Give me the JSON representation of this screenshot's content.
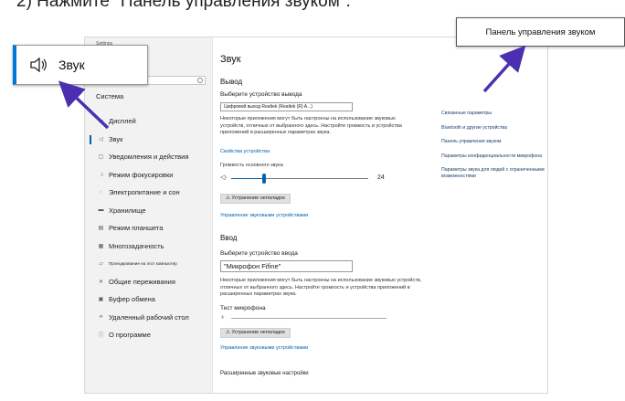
{
  "instruction": "2) Нажмите \"Панель управления звуком\".",
  "window": {
    "title": "Settings",
    "system_label": "Система",
    "nav": [
      {
        "label": "Дисплей",
        "icon": "display-icon",
        "small": false,
        "active": false
      },
      {
        "label": "Звук",
        "icon": "speaker-icon",
        "small": false,
        "active": true
      },
      {
        "label": "Уведомления и действия",
        "icon": "notifications-icon",
        "small": false,
        "active": false
      },
      {
        "label": "Режим фокусировки",
        "icon": "moon-icon",
        "small": false,
        "active": false
      },
      {
        "label": "Электропитание и сон",
        "icon": "power-icon",
        "small": false,
        "active": false
      },
      {
        "label": "Хранилище",
        "icon": "storage-icon",
        "small": false,
        "active": false
      },
      {
        "label": "Режим планшета",
        "icon": "tablet-icon",
        "small": false,
        "active": false
      },
      {
        "label": "Многозадачность",
        "icon": "multitask-icon",
        "small": false,
        "active": false
      },
      {
        "label": "Проецирование на этот компьютер",
        "icon": "project-icon",
        "small": true,
        "active": false
      },
      {
        "label": "Общие переживания",
        "icon": "shared-icon",
        "small": false,
        "active": false
      },
      {
        "label": "Буфер обмена",
        "icon": "clipboard-icon",
        "small": false,
        "active": false
      },
      {
        "label": "Удаленный рабочий стол",
        "icon": "remote-icon",
        "small": false,
        "active": false
      },
      {
        "label": "О программе",
        "icon": "info-icon",
        "small": false,
        "active": false
      }
    ]
  },
  "content": {
    "title": "Звук",
    "output": {
      "heading": "Вывод",
      "choose_label": "Выберите устройство вывода",
      "device": "Цифровой выход Realtek (Realtek (R) A...)",
      "note": "Некоторые приложения могут быть настроены на использование звуковых устройств, отличных от выбранного здесь. Настройте громкость и устройства приложений в расширенных параметрах звука.",
      "properties_link": "Свойства устройства",
      "volume_label": "Громкость основного звука",
      "volume_value": "24",
      "volume_level": 0.24,
      "troubleshoot": "Устранение неполадок",
      "manage_link": "Управление звуковыми устройствами"
    },
    "input": {
      "heading": "Ввод",
      "choose_label": "Выберите устройство ввода",
      "device": "\"Микрофон Fifine\"",
      "note": "Некоторые приложения могут быть настроены на использование звуковых устройств, отличных от выбранного здесь. Настройте громкость и устройства приложений в расширенных параметрах звука.",
      "test_label": "Тест микрофона",
      "troubleshoot": "Устранение неполадок",
      "manage_link": "Управление звуковыми устройствами"
    },
    "advanced_label": "Расширенные звуковые настройки"
  },
  "related": [
    "Связанные параметры",
    "Bluetooth и другие устройства",
    "Панель управления звуком",
    "Параметры конфиденциальности микрофона",
    "Параметры звука для людей с ограниченными возможностями"
  ],
  "callouts": {
    "left_label": "Звук",
    "right_label": "Панель управления звуком"
  },
  "colors": {
    "accent": "#0063b1",
    "arrow": "#4b2fb0",
    "callout_bar": "#0078d7"
  }
}
